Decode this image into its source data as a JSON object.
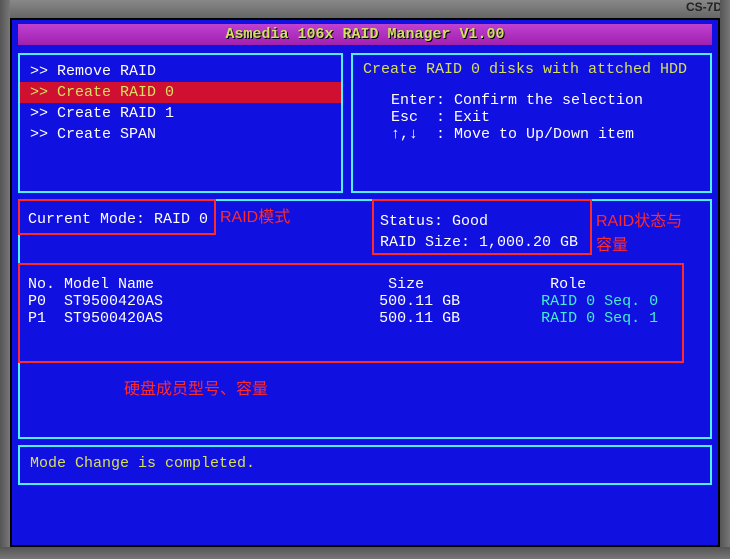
{
  "bezel": {
    "model": "CS-7D"
  },
  "title": "Asmedia 106x RAID Manager V1.00",
  "menu": {
    "items": [
      {
        "label": ">> Remove RAID",
        "selected": false
      },
      {
        "label": ">> Create RAID 0",
        "selected": true
      },
      {
        "label": ">> Create RAID 1",
        "selected": false
      },
      {
        "label": ">> Create SPAN",
        "selected": false
      }
    ]
  },
  "info": {
    "heading": "Create RAID 0 disks with attched HDD",
    "lines": [
      "Enter: Confirm the selection",
      "Esc  : Exit",
      "↑,↓  : Move to Up/Down item"
    ]
  },
  "mode": {
    "label": "Current Mode:",
    "value": "RAID 0"
  },
  "status": {
    "status_label": "Status:",
    "status_value": "Good",
    "size_label": "RAID Size:",
    "size_value": "1,000.20 GB"
  },
  "disks": {
    "headers": {
      "no": "No.",
      "model": "Model Name",
      "size": "Size",
      "role": "Role"
    },
    "rows": [
      {
        "no": "P0",
        "model": "ST9500420AS",
        "size": "500.11 GB",
        "role": "RAID 0 Seq. 0"
      },
      {
        "no": "P1",
        "model": "ST9500420AS",
        "size": "500.11 GB",
        "role": "RAID 0 Seq. 1"
      }
    ]
  },
  "footer": {
    "message": "Mode Change is completed."
  },
  "annotations": {
    "mode_label": "RAID模式",
    "status_label": "RAID状态与容量",
    "disks_label": "硬盘成员型号、容量"
  }
}
